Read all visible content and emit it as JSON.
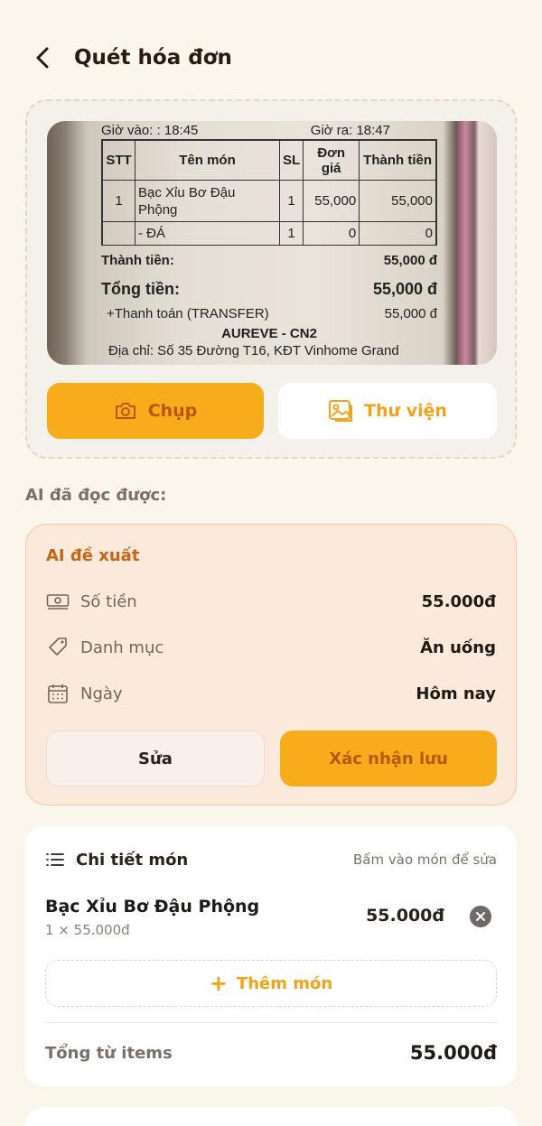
{
  "header": {
    "title": "Quét hóa đơn"
  },
  "receipt": {
    "time_in": "Giờ vào: : 18:45",
    "time_out": "Giờ ra: 18:47",
    "cols": [
      "STT",
      "Tên món",
      "SL",
      "Đơn giá",
      "Thành tiền"
    ],
    "rows": [
      [
        "1",
        "Bạc Xỉu Bơ Đậu Phộng",
        "1",
        "55,000",
        "55,000"
      ],
      [
        "",
        "- ĐÁ",
        "1",
        "0",
        "0"
      ]
    ],
    "subtotal_label": "Thành tiền:",
    "subtotal_value": "55,000 đ",
    "total_label": "Tổng tiền:",
    "total_value": "55,000 đ",
    "payment_label": "+Thanh toán (TRANSFER)",
    "payment_value": "55,000 đ",
    "store": "AUREVE - CN2",
    "address": "Địa chỉ: Số 35 Đường T16, KĐT Vinhome Grand"
  },
  "scan": {
    "capture_label": "Chụp",
    "library_label": "Thư viện"
  },
  "ai": {
    "section_label": "AI đã đọc được:",
    "title": "AI đề xuất",
    "fields": [
      {
        "label": "Số tiền",
        "value": "55.000đ",
        "icon": "money-icon"
      },
      {
        "label": "Danh mục",
        "value": "Ăn uống",
        "icon": "tag-icon"
      },
      {
        "label": "Ngày",
        "value": "Hôm nay",
        "icon": "calendar-icon"
      }
    ],
    "edit_label": "Sửa",
    "confirm_label": "Xác nhận lưu"
  },
  "details": {
    "title": "Chi tiết món",
    "hint": "Bấm vào món để sửa",
    "items": [
      {
        "name": "Bạc Xỉu Bơ Đậu Phộng",
        "qty_price": "1 × 55.000đ",
        "price": "55.000đ"
      }
    ],
    "add_label": "Thêm món",
    "total_label": "Tổng từ items",
    "total_value": "55.000đ"
  },
  "colors": {
    "accent": "#f7ad1b",
    "accent_text": "#b85710",
    "background": "#fbf6ec",
    "ai_card": "#fbeadb"
  }
}
